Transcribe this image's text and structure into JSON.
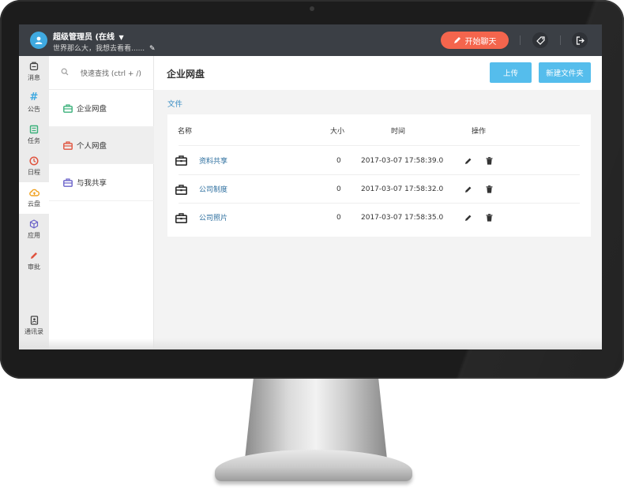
{
  "header": {
    "user_name": "超级管理员 (在线",
    "user_signature": "世界那么大，我想去看看......",
    "chat_button": "开始聊天"
  },
  "left_nav": [
    {
      "label": "消息",
      "icon": "message-icon"
    },
    {
      "label": "公告",
      "icon": "hash-icon",
      "color": "#3fa9e0"
    },
    {
      "label": "任务",
      "icon": "task-icon",
      "color": "#3ab07a"
    },
    {
      "label": "日程",
      "icon": "schedule-icon",
      "color": "#e0533e"
    },
    {
      "label": "云盘",
      "icon": "cloud-icon",
      "color": "#f0a11f",
      "active": true
    },
    {
      "label": "应用",
      "icon": "cube-icon",
      "color": "#6a62c9"
    },
    {
      "label": "审批",
      "icon": "approval-icon",
      "color": "#e0533e"
    },
    {
      "label": "通讯录",
      "icon": "contacts-icon"
    }
  ],
  "subnav": {
    "search_placeholder": "快速查找 (ctrl + /)",
    "items": [
      {
        "label": "企业网盘",
        "color": "#3ab07a"
      },
      {
        "label": "个人网盘",
        "color": "#e0533e",
        "active": true
      },
      {
        "label": "与我共享",
        "color": "#6a62c9"
      }
    ]
  },
  "main": {
    "title": "企业网盘",
    "upload_button": "上传",
    "new_folder_button": "新建文件夹",
    "breadcrumb": "文件",
    "columns": {
      "name": "名称",
      "size": "大小",
      "time": "时间",
      "actions": "操作"
    },
    "rows": [
      {
        "name": "资料共享",
        "size": "0",
        "time": "2017-03-07 17:58:39.0"
      },
      {
        "name": "公司制度",
        "size": "0",
        "time": "2017-03-07 17:58:32.0"
      },
      {
        "name": "公司照片",
        "size": "0",
        "time": "2017-03-07 17:58:35.0"
      }
    ]
  }
}
